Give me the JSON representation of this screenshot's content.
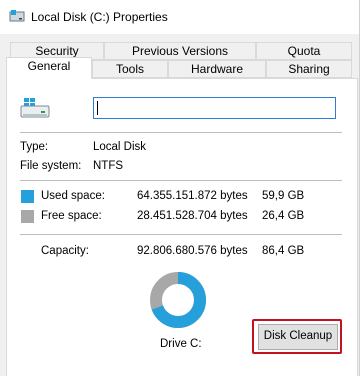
{
  "window": {
    "title": "Local Disk (C:) Properties",
    "icon": "drive-icon"
  },
  "tabs_row1": [
    "Security",
    "Previous Versions",
    "Quota"
  ],
  "tabs_row2": [
    "General",
    "Tools",
    "Hardware",
    "Sharing"
  ],
  "active_tab": "General",
  "general": {
    "drive_icon": "windows-drive-icon",
    "name_value": "",
    "type_label": "Type:",
    "type_value": "Local Disk",
    "fs_label": "File system:",
    "fs_value": "NTFS",
    "used_label": "Used space:",
    "used_bytes": "64.355.151.872 bytes",
    "used_gb": "59,9 GB",
    "free_label": "Free space:",
    "free_bytes": "28.451.528.704 bytes",
    "free_gb": "26,4 GB",
    "capacity_label": "Capacity:",
    "capacity_bytes": "92.806.680.576 bytes",
    "capacity_gb": "86,4 GB",
    "drive_label": "Drive C:",
    "disk_cleanup_label": "Disk Cleanup"
  },
  "usage": {
    "used_fraction": 0.693
  },
  "colors": {
    "used": "#26a0da",
    "free": "#a8a8a8",
    "highlight": "#c3121f",
    "focus": "#2d7dd2"
  }
}
